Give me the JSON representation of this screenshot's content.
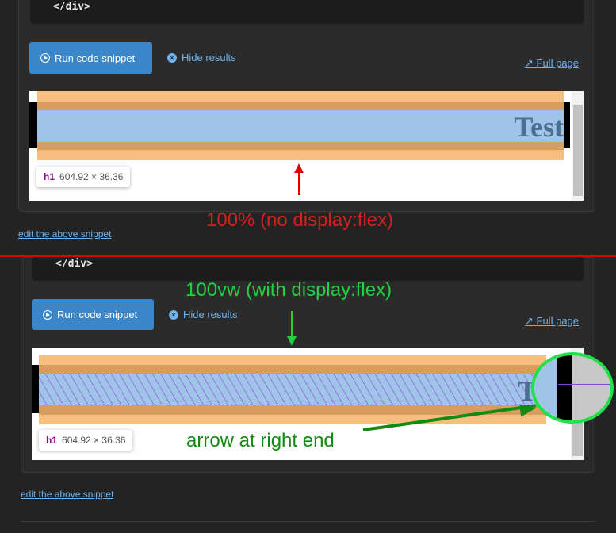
{
  "top": {
    "code_tail": "</div>",
    "run_label": "Run code snippet",
    "hide_label": "Hide results",
    "full_label": "Full page",
    "result_text": "Test",
    "tooltip_tag": "h1",
    "tooltip_size": "604.92 × 36.36",
    "edit_label": "edit the above snippet"
  },
  "bottom": {
    "code_tail": "</div>",
    "run_label": "Run code snippet",
    "hide_label": "Hide results",
    "full_label": "Full page",
    "result_text": "Tt",
    "tooltip_tag": "h1",
    "tooltip_size": "604.92 × 36.36",
    "edit_label": "edit the above snippet"
  },
  "annotations": {
    "top_note": "100% (no display:flex)",
    "bottom_note": "100vw (with display:flex)",
    "arrow_note": "arrow at right end",
    "colors": {
      "red": "#e00000",
      "green": "#1a8a1a",
      "bright_green": "#22e04a"
    }
  }
}
